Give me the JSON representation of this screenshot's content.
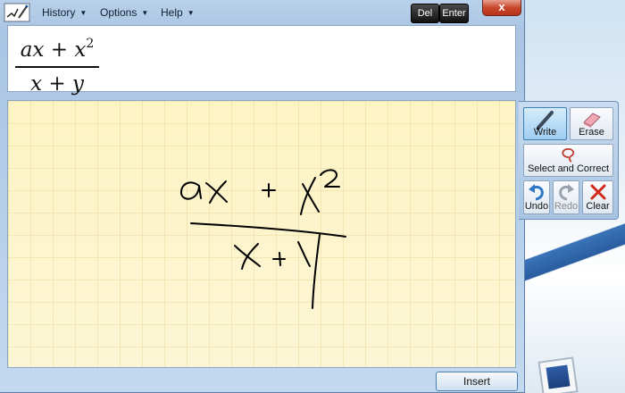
{
  "menu": {
    "history": "History",
    "options": "Options",
    "help": "Help"
  },
  "keys": {
    "del": "Del",
    "enter": "Enter"
  },
  "close": "x",
  "preview": {
    "numerator": "ax + x",
    "exponent": "2",
    "denominator": "x + y"
  },
  "tools": {
    "write": "Write",
    "erase": "Erase",
    "select_correct": "Select and Correct",
    "undo": "Undo",
    "redo": "Redo",
    "clear": "Clear"
  },
  "insert": "Insert",
  "colors": {
    "canvas_bg": "#fdf3c3",
    "grid_line": "#e8d99a",
    "ink": "#000000"
  }
}
